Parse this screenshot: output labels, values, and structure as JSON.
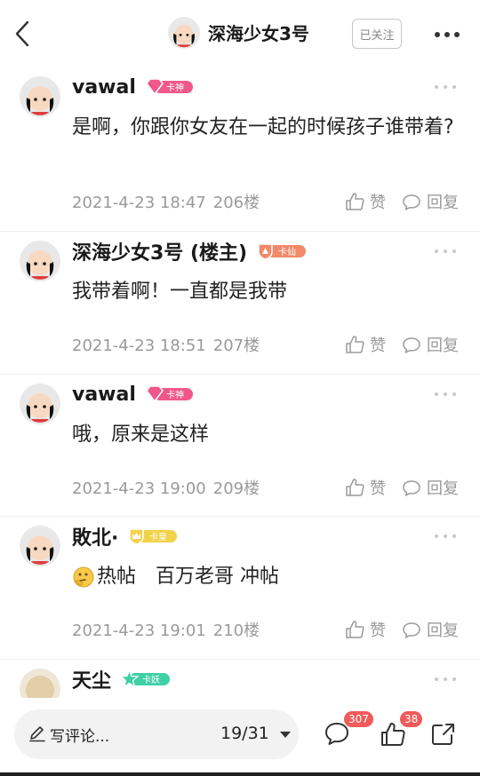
{
  "header": {
    "title": "深海少女3号",
    "follow_label": "已关注",
    "back_icon": "back-arrow-icon",
    "more_icon": "more-dots-icon"
  },
  "posts": [
    {
      "username": "vawal",
      "badge": "卡神",
      "badge_color": "#f0588a",
      "content": "是啊，你跟你女友在一起的时候孩子谁带着?",
      "date": "2021-4-23 18:47",
      "floor": "206楼"
    },
    {
      "username": "深海少女3号 (楼主)",
      "badge": "卡仙",
      "badge_color": "#f08a6a",
      "content": "我带着啊！一直都是我带",
      "date": "2021-4-23 18:51",
      "floor": "207楼"
    },
    {
      "username": "vawal",
      "badge": "卡神",
      "badge_color": "#f0588a",
      "content": "哦，原来是这样",
      "date": "2021-4-23 19:00",
      "floor": "209楼"
    },
    {
      "username": "敗北·",
      "badge": "卡皇",
      "badge_color": "#f2d24a",
      "content": "热帖　百万老哥 冲帖",
      "emoji_icon": "thinking-emoji-icon",
      "date": "2021-4-23 19:01",
      "floor": "210楼"
    },
    {
      "username": "天尘",
      "badge": "卡妖",
      "badge_color": "#3fd0a6"
    }
  ],
  "actions": {
    "like_label": "赞",
    "reply_label": "回复"
  },
  "bottom": {
    "placeholder": "写评论...",
    "page_indicator": "19/31",
    "comment_count": "307",
    "like_count": "38"
  },
  "colors": {
    "badge_red": "#f05a5a",
    "meta_gray": "#9a9a9a"
  }
}
